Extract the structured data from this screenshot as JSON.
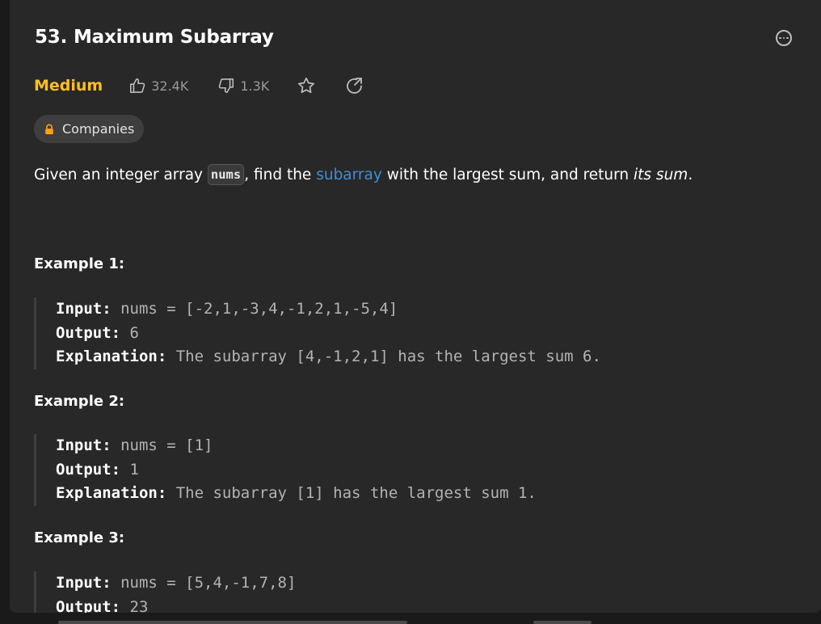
{
  "problem": {
    "title": "53. Maximum Subarray",
    "difficulty": "Medium",
    "likes": "32.4K",
    "dislikes": "1.3K",
    "companies_label": "Companies"
  },
  "description": {
    "part1": "Given an integer array ",
    "code": "nums",
    "part2": ", find the ",
    "link": "subarray",
    "part3": " with the largest sum, and return ",
    "em": "its sum",
    "part4": "."
  },
  "examples": [
    {
      "heading": "Example 1:",
      "input_label": "Input:",
      "input": " nums = [-2,1,-3,4,-1,2,1,-5,4]",
      "output_label": "Output:",
      "output": " 6",
      "explanation_label": "Explanation:",
      "explanation": " The subarray [4,-1,2,1] has the largest sum 6."
    },
    {
      "heading": "Example 2:",
      "input_label": "Input:",
      "input": " nums = [1]",
      "output_label": "Output:",
      "output": " 1",
      "explanation_label": "Explanation:",
      "explanation": " The subarray [1] has the largest sum 1."
    },
    {
      "heading": "Example 3:",
      "input_label": "Input:",
      "input": " nums = [5,4,-1,7,8]",
      "output_label": "Output:",
      "output": " 23"
    }
  ],
  "colors": {
    "background": "#282828",
    "difficulty_medium": "#ffc01e",
    "link": "#3e8ed9"
  },
  "icons": {
    "more": "more-horizontal-circle-icon",
    "like": "thumbs-up-icon",
    "dislike": "thumbs-down-icon",
    "favorite": "star-icon",
    "share": "share-icon",
    "lock": "lock-icon"
  }
}
